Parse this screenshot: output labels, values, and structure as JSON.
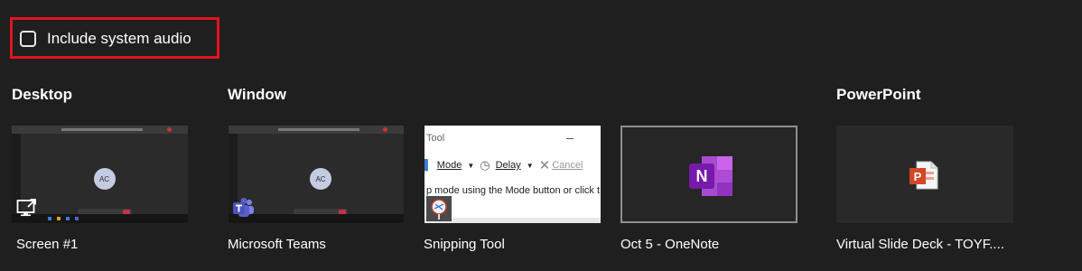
{
  "audio": {
    "label": "Include system audio",
    "checked": false,
    "highlight_color": "#e0141e"
  },
  "sections": {
    "desktop": "Desktop",
    "window": "Window",
    "powerpoint": "PowerPoint"
  },
  "thumbnails": [
    {
      "caption": "Screen #1",
      "avatar_initials": "AC",
      "overlay_icon": "share-screen-icon"
    },
    {
      "caption": "Microsoft Teams",
      "avatar_initials": "AC",
      "overlay_icon": "teams-icon"
    },
    {
      "caption": "Snipping Tool",
      "title_text": "Tool",
      "toolbar": [
        "Mode",
        "Delay",
        "Cancel"
      ],
      "body_text": "p mode using the Mode button or click t",
      "overlay_icon": "snipping-tool-icon"
    },
    {
      "caption": "Oct 5 - OneNote",
      "app_icon": "onenote-icon",
      "app_letter": "N"
    },
    {
      "caption": "Virtual Slide Deck - TOYF....",
      "app_icon": "powerpoint-icon",
      "app_letter": "P"
    }
  ],
  "colors": {
    "background": "#1f1f1f",
    "onenote": "#7719aa",
    "powerpoint": "#d24726",
    "teams": "#5b5fc7"
  }
}
